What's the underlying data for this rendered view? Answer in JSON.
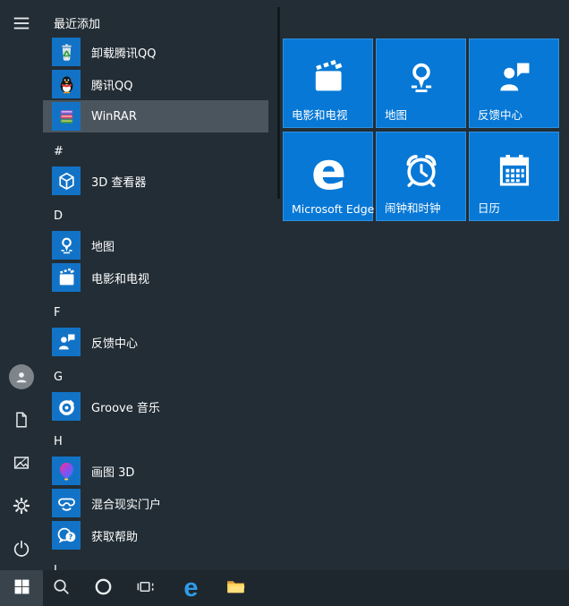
{
  "colors": {
    "menu_bg": "#222d35",
    "tile_blue": "#0778d6",
    "app_icon_blue": "#1273c6",
    "highlight_row": "#4b555d",
    "taskbar_bg": "#1e272e",
    "start_button_active": "#39434b",
    "text": "#ffffff"
  },
  "nav_rail": {
    "menu_button": "expand-start-menu",
    "user_button": "user-account",
    "items": [
      "documents",
      "pictures",
      "settings",
      "power"
    ]
  },
  "app_list": {
    "sections": [
      {
        "header": "最近添加",
        "items": [
          {
            "label": "卸载腾讯QQ",
            "icon": "uninstall-qq-icon"
          },
          {
            "label": "腾讯QQ",
            "icon": "qq-icon"
          },
          {
            "label": "WinRAR",
            "icon": "winrar-icon",
            "highlighted": true
          }
        ]
      },
      {
        "header": "#",
        "items": [
          {
            "label": "3D 查看器",
            "icon": "3d-viewer-icon"
          }
        ]
      },
      {
        "header": "D",
        "items": [
          {
            "label": "地图",
            "icon": "maps-icon"
          },
          {
            "label": "电影和电视",
            "icon": "movies-tv-icon"
          }
        ]
      },
      {
        "header": "F",
        "items": [
          {
            "label": "反馈中心",
            "icon": "feedback-hub-icon"
          }
        ]
      },
      {
        "header": "G",
        "items": [
          {
            "label": "Groove 音乐",
            "icon": "groove-music-icon"
          }
        ]
      },
      {
        "header": "H",
        "items": [
          {
            "label": "画图 3D",
            "icon": "paint-3d-icon"
          },
          {
            "label": "混合现实门户",
            "icon": "mixed-reality-icon"
          },
          {
            "label": "获取帮助",
            "icon": "get-help-icon"
          }
        ]
      },
      {
        "header": "I",
        "items": []
      }
    ]
  },
  "tiles": [
    {
      "label": "电影和电视",
      "icon": "movies-tv-icon"
    },
    {
      "label": "地图",
      "icon": "maps-icon"
    },
    {
      "label": "反馈中心",
      "icon": "feedback-hub-icon"
    },
    {
      "label": "Microsoft Edge",
      "icon": "edge-icon"
    },
    {
      "label": "闹钟和时钟",
      "icon": "alarms-clock-icon"
    },
    {
      "label": "日历",
      "icon": "calendar-icon"
    }
  ],
  "icons": {
    "edge_glyph": "e",
    "question_glyph": "?"
  },
  "taskbar": {
    "buttons": [
      "start",
      "search",
      "cortana",
      "task-view",
      "microsoft-edge",
      "file-explorer"
    ]
  }
}
